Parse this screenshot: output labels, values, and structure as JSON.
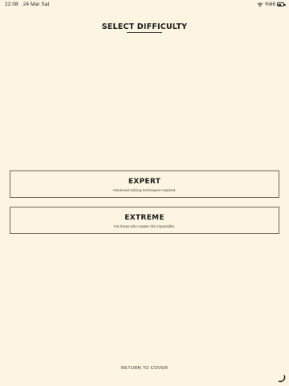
{
  "status_bar": {
    "time": "22:08",
    "date": "24 Mar Sal",
    "battery_text": "%66",
    "battery_level": 0.66
  },
  "screen": {
    "title": "SELECT DIFFICULTY"
  },
  "difficulties": [
    {
      "title": "EXPERT",
      "subtitle": "Advanced solving techniques required."
    },
    {
      "title": "EXTREME",
      "subtitle": "For those who master the impossible."
    }
  ],
  "footer": {
    "return_label": "RETURN TO COVER"
  },
  "icons": {
    "wifi": "wifi-icon",
    "battery": "battery-icon",
    "spinner": "loading-spinner-icon"
  },
  "colors": {
    "background": "#FDF5E2",
    "border": "#6b6558",
    "text": "#1a1a1a"
  }
}
